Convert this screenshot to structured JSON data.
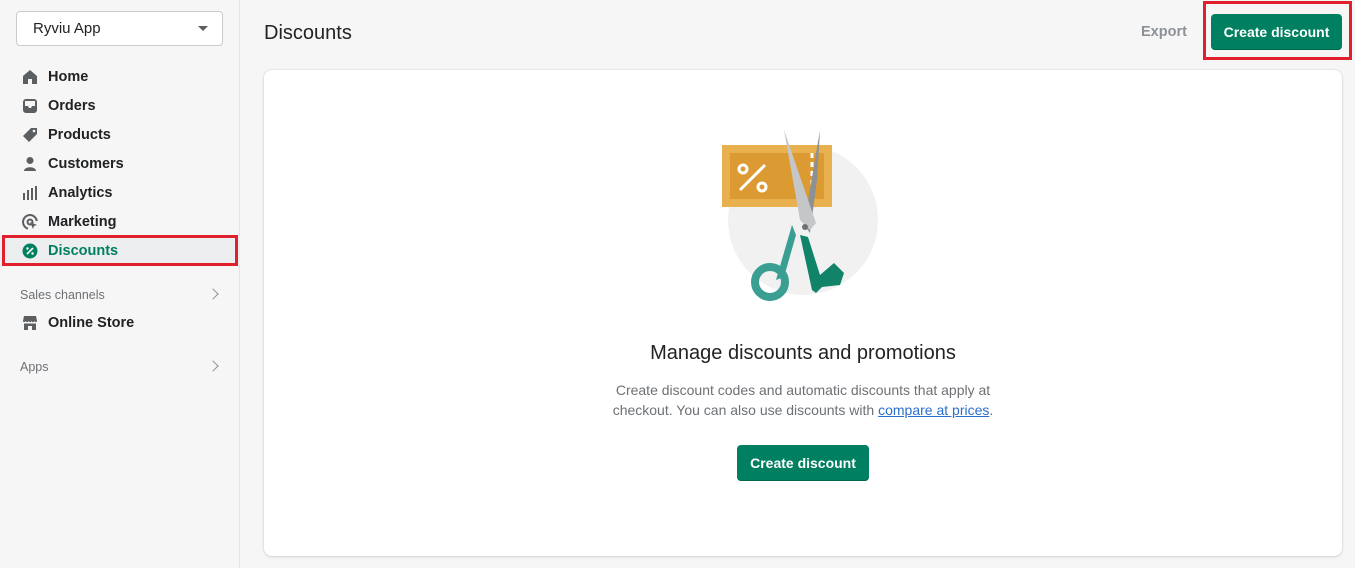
{
  "sidebar": {
    "store_name": "Ryviu App",
    "items": [
      {
        "label": "Home",
        "icon": "home-icon"
      },
      {
        "label": "Orders",
        "icon": "orders-icon"
      },
      {
        "label": "Products",
        "icon": "tag-icon"
      },
      {
        "label": "Customers",
        "icon": "person-icon"
      },
      {
        "label": "Analytics",
        "icon": "bar-chart-icon"
      },
      {
        "label": "Marketing",
        "icon": "target-icon"
      },
      {
        "label": "Discounts",
        "icon": "discount-icon",
        "active": true
      }
    ],
    "sales_channels_label": "Sales channels",
    "online_store_label": "Online Store",
    "apps_label": "Apps"
  },
  "header": {
    "title": "Discounts",
    "export_label": "Export",
    "create_label": "Create discount"
  },
  "empty_state": {
    "title": "Manage discounts and promotions",
    "desc_prefix": "Create discount codes and automatic discounts that apply at checkout. You can also use discounts with ",
    "desc_link": "compare at prices",
    "desc_suffix": ".",
    "button_label": "Create discount"
  },
  "colors": {
    "brand_green": "#008060",
    "highlight_red": "#e0202c",
    "link_blue": "#2c6ecb"
  }
}
